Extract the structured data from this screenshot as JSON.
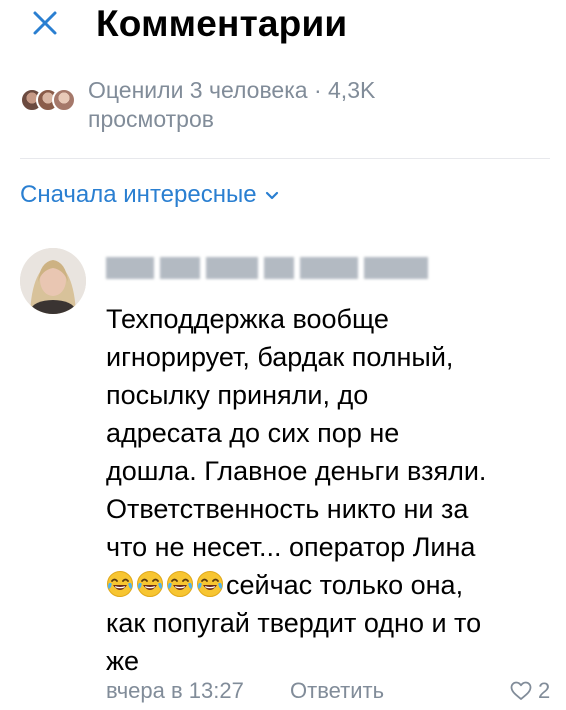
{
  "header": {
    "title": "Комментарии",
    "close_icon": "close-icon"
  },
  "likes": {
    "summary": "Оценили 3 человека · 4,3K просмотров"
  },
  "sort": {
    "label": "Сначала интересные",
    "icon": "chevron-down-icon"
  },
  "comment": {
    "author_redacted": true,
    "text_lines": [
      "Техподдержка вообще",
      "игнорирует, бардак полный,",
      "посылку приняли, до",
      "адресата до сих пор не",
      "дошла. Главное деньги взяли.",
      "Ответственность никто ни за",
      "что не несет... оператор Лина"
    ],
    "emoji_line_suffix": "сейчас только она,",
    "emoji_count": 4,
    "tail_lines": [
      "как попугай твердит одно и то",
      "же"
    ],
    "time": "вчера в 13:27",
    "reply_label": "Ответить",
    "like_count": "2"
  },
  "colors": {
    "accent": "#2a7fd1",
    "secondary_text": "#818c99",
    "divider": "#e7e8ec"
  }
}
